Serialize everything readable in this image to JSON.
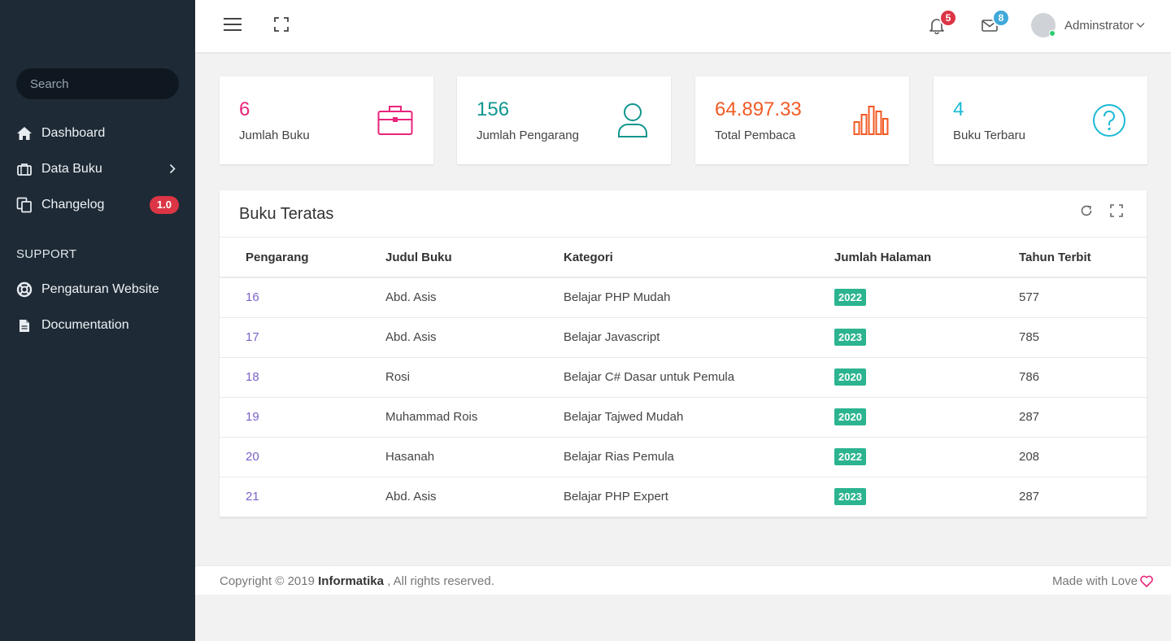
{
  "sidebar": {
    "search_placeholder": "Search",
    "items": [
      {
        "label": "Dashboard",
        "icon": "home-icon"
      },
      {
        "label": "Data Buku",
        "icon": "briefcase-icon"
      },
      {
        "label": "Changelog",
        "icon": "copy-icon",
        "badge": "1.0"
      }
    ],
    "section_title": "SUPPORT",
    "support_items": [
      {
        "label": "Pengaturan Website",
        "icon": "lifebuoy-icon"
      },
      {
        "label": "Documentation",
        "icon": "document-icon"
      }
    ]
  },
  "topbar": {
    "notifications_count": "5",
    "messages_count": "8",
    "user_name": "Adminstrator"
  },
  "stats": [
    {
      "value": "6",
      "label": "Jumlah Buku",
      "color": "#e8247a",
      "icon": "briefcase-icon"
    },
    {
      "value": "156",
      "label": "Jumlah Pengarang",
      "color": "#10968f",
      "icon": "user-icon"
    },
    {
      "value": "64.897.33",
      "label": "Total Pembaca",
      "color": "#f15a24",
      "icon": "bar-chart-icon"
    },
    {
      "value": "4",
      "label": "Buku Terbaru",
      "color": "#1bb9d6",
      "icon": "question-icon"
    }
  ],
  "table": {
    "title": "Buku Teratas",
    "columns": [
      "Pengarang",
      "Judul Buku",
      "Kategori",
      "Jumlah Halaman",
      "Tahun Terbit"
    ],
    "rows": [
      [
        "16",
        "Abd. Asis",
        "Belajar PHP Mudah",
        "2022",
        "577"
      ],
      [
        "17",
        "Abd. Asis",
        "Belajar Javascript",
        "2023",
        "785"
      ],
      [
        "18",
        "Rosi",
        "Belajar C# Dasar untuk Pemula",
        "2020",
        "786"
      ],
      [
        "19",
        "Muhammad Rois",
        "Belajar Tajwed Mudah",
        "2020",
        "287"
      ],
      [
        "20",
        "Hasanah",
        "Belajar Rias Pemula",
        "2022",
        "208"
      ],
      [
        "21",
        "Abd. Asis",
        "Belajar PHP Expert",
        "2023",
        "287"
      ]
    ]
  },
  "footer": {
    "copyright_prefix": "Copyright © 2019",
    "brand": "Informatika",
    "copyright_suffix": ", All rights reserved.",
    "made_with": "Made with Love"
  },
  "colors": {
    "sidebar_bg": "#1e2a35",
    "badge_red": "#dc3545",
    "badge_blue": "#3fa9d9",
    "year_badge": "#2bb48f",
    "link": "#7b61c8"
  }
}
